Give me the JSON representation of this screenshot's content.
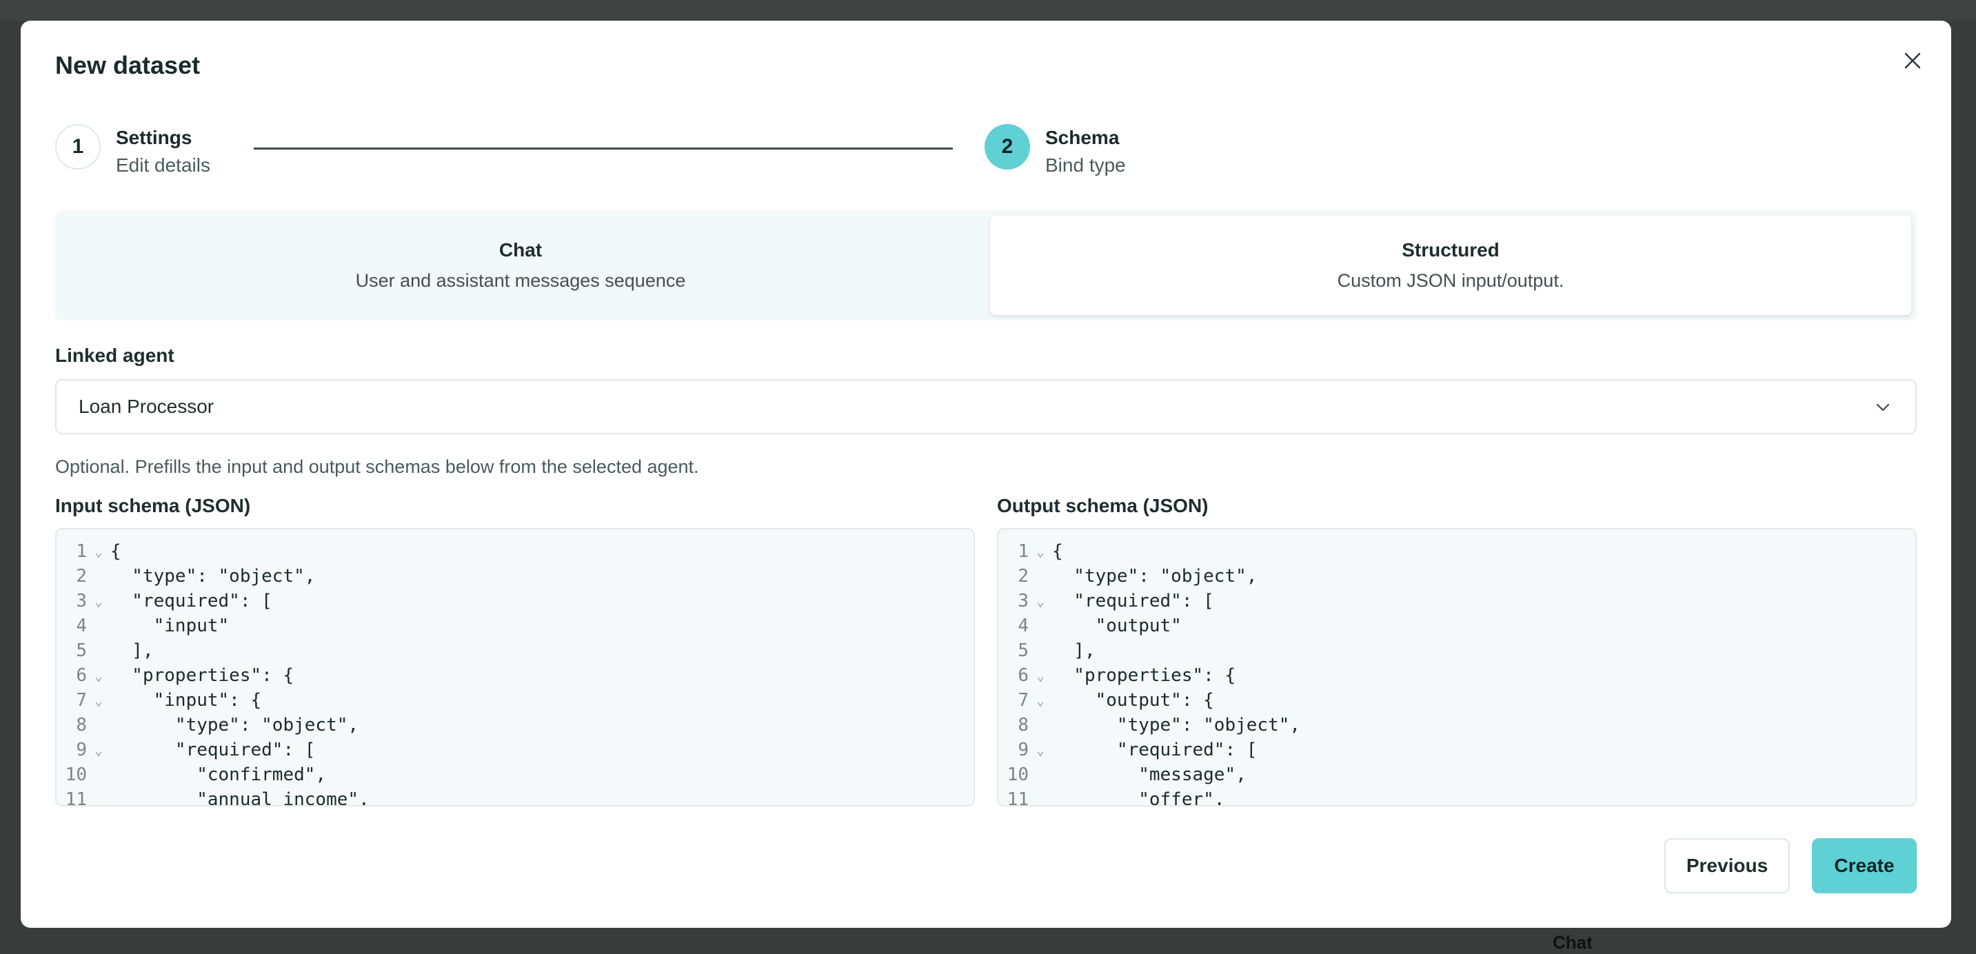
{
  "modal": {
    "title": "New dataset"
  },
  "stepper": {
    "steps": [
      {
        "number": "1",
        "label": "Settings",
        "sublabel": "Edit details"
      },
      {
        "number": "2",
        "label": "Schema",
        "sublabel": "Bind type"
      }
    ]
  },
  "dataset_types": [
    {
      "title": "Chat",
      "description": "User and assistant messages sequence"
    },
    {
      "title": "Structured",
      "description": "Custom JSON input/output."
    }
  ],
  "linked_agent": {
    "label": "Linked agent",
    "value": "Loan Processor",
    "hint": "Optional. Prefills the input and output schemas below from the selected agent."
  },
  "input_schema": {
    "label": "Input schema (JSON)",
    "lines": [
      {
        "n": "1",
        "text": "{"
      },
      {
        "n": "2",
        "text": "  \"type\": \"object\","
      },
      {
        "n": "3",
        "text": "  \"required\": ["
      },
      {
        "n": "4",
        "text": "    \"input\""
      },
      {
        "n": "5",
        "text": "  ],"
      },
      {
        "n": "6",
        "text": "  \"properties\": {"
      },
      {
        "n": "7",
        "text": "    \"input\": {"
      },
      {
        "n": "8",
        "text": "      \"type\": \"object\","
      },
      {
        "n": "9",
        "text": "      \"required\": ["
      },
      {
        "n": "10",
        "text": "        \"confirmed\","
      },
      {
        "n": "11",
        "text": "        \"annual_income\","
      }
    ]
  },
  "output_schema": {
    "label": "Output schema (JSON)",
    "lines": [
      {
        "n": "1",
        "text": "{"
      },
      {
        "n": "2",
        "text": "  \"type\": \"object\","
      },
      {
        "n": "3",
        "text": "  \"required\": ["
      },
      {
        "n": "4",
        "text": "    \"output\""
      },
      {
        "n": "5",
        "text": "  ],"
      },
      {
        "n": "6",
        "text": "  \"properties\": {"
      },
      {
        "n": "7",
        "text": "    \"output\": {"
      },
      {
        "n": "8",
        "text": "      \"type\": \"object\","
      },
      {
        "n": "9",
        "text": "      \"required\": ["
      },
      {
        "n": "10",
        "text": "        \"message\","
      },
      {
        "n": "11",
        "text": "        \"offer\","
      }
    ]
  },
  "buttons": {
    "previous": "Previous",
    "create": "Create"
  },
  "background": {
    "tab_label": "Chat"
  },
  "colors": {
    "accent": "#5fd0d3",
    "overlay": "#3a3b3b",
    "tab_background": "#f1faf9"
  }
}
